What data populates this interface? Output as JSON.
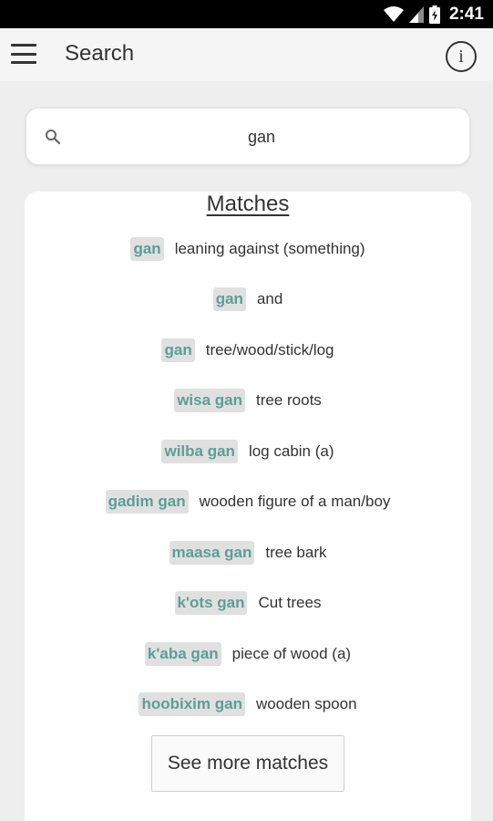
{
  "status_bar": {
    "time": "2:41",
    "icons": [
      "wifi-icon",
      "signal-icon",
      "battery-icon"
    ]
  },
  "app_bar": {
    "title": "Search",
    "menu_icon": "hamburger-menu-icon",
    "info_icon": "info-icon",
    "info_glyph": "i"
  },
  "search": {
    "value": "gan",
    "icon": "search-icon"
  },
  "results": {
    "heading": "Matches",
    "items": [
      {
        "word": "gan",
        "definition": "leaning against (something)"
      },
      {
        "word": "gan",
        "definition": "and"
      },
      {
        "word": "gan",
        "definition": "tree/wood/stick/log"
      },
      {
        "word": "wisa gan",
        "definition": "tree roots"
      },
      {
        "word": "wilba gan",
        "definition": "log cabin (a)"
      },
      {
        "word": "gadim gan",
        "definition": "wooden figure of a man/boy"
      },
      {
        "word": "maasa gan",
        "definition": "tree bark"
      },
      {
        "word": "k'ots gan",
        "definition": "Cut trees"
      },
      {
        "word": "k'aba gan",
        "definition": "piece of wood (a)"
      },
      {
        "word": "hoobixim gan",
        "definition": "wooden spoon"
      }
    ],
    "more_button": "See more matches"
  },
  "colors": {
    "accent_word": "#5c9e97",
    "word_bg": "#e0e0e0",
    "page_bg": "#eeeeee",
    "card_bg": "#ffffff"
  }
}
